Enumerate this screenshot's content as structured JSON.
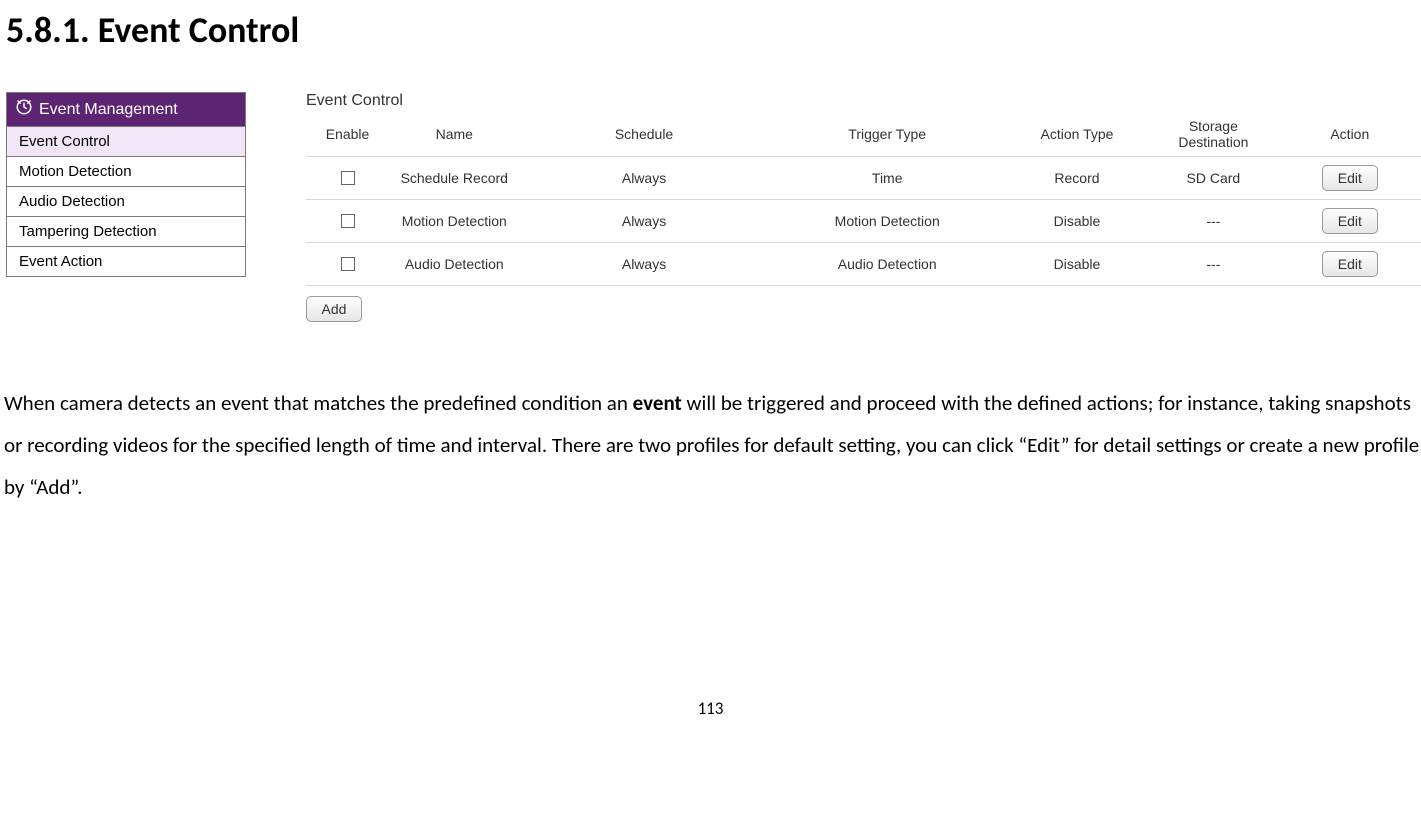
{
  "heading": "5.8.1.   Event Control",
  "sidebar": {
    "title": "Event Management",
    "items": [
      {
        "label": "Event Control",
        "active": true
      },
      {
        "label": "Motion Detection",
        "active": false
      },
      {
        "label": "Audio Detection",
        "active": false
      },
      {
        "label": "Tampering Detection",
        "active": false
      },
      {
        "label": "Event Action",
        "active": false
      }
    ]
  },
  "panel": {
    "title": "Event Control",
    "columns": {
      "enable": "Enable",
      "name": "Name",
      "schedule": "Schedule",
      "trigger": "Trigger Type",
      "action_type": "Action Type",
      "storage": "Storage Destination",
      "action": "Action"
    },
    "rows": [
      {
        "name": "Schedule Record",
        "schedule": "Always",
        "trigger": "Time",
        "action_type": "Record",
        "storage": "SD Card",
        "edit_label": "Edit"
      },
      {
        "name": "Motion Detection",
        "schedule": "Always",
        "trigger": "Motion Detection",
        "action_type": "Disable",
        "storage": "---",
        "edit_label": "Edit"
      },
      {
        "name": "Audio Detection",
        "schedule": "Always",
        "trigger": "Audio Detection",
        "action_type": "Disable",
        "storage": "---",
        "edit_label": "Edit"
      }
    ],
    "add_label": "Add"
  },
  "body": {
    "t1": "When camera detects an event that matches the predefined condition an ",
    "t_bold": "event",
    "t2": " will be triggered and proceed with the defined actions; for instance, taking snapshots or recording videos for the specified length of time and interval. There are two profiles for default setting, you can click “Edit” for detail settings or create a new profile by “Add”."
  },
  "page_number": "113"
}
